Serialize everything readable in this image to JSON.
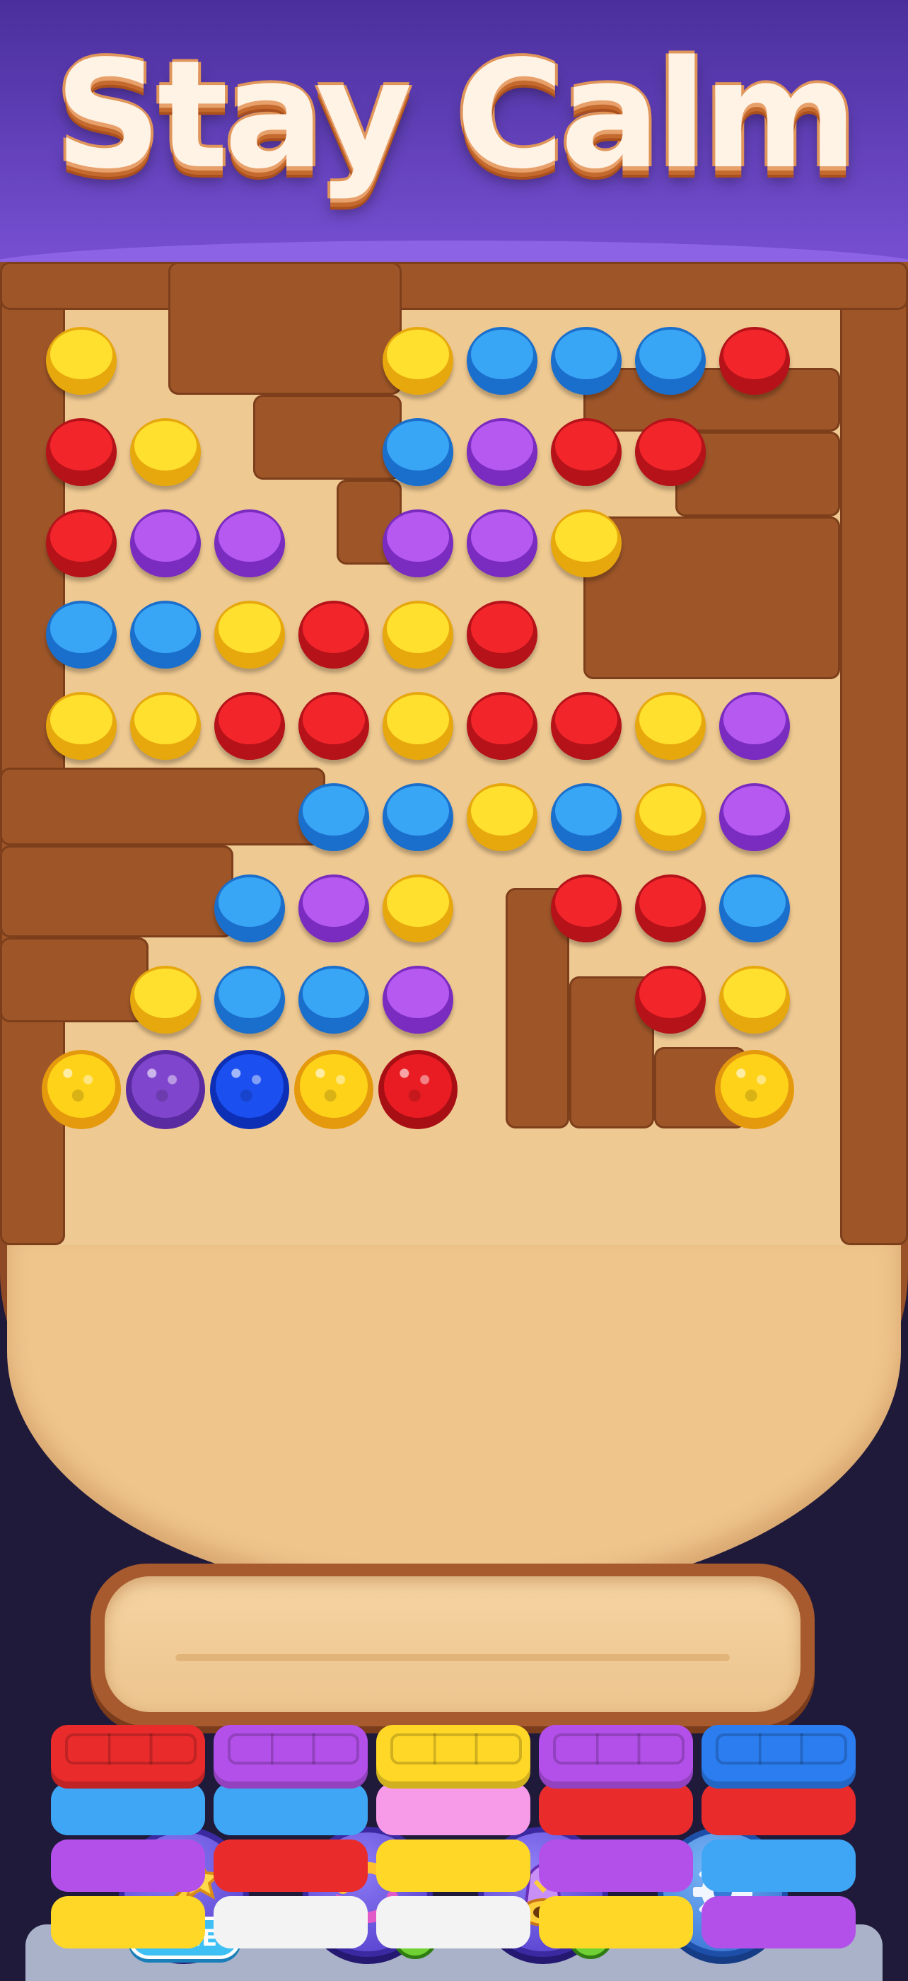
{
  "level_title": "Stay Calm",
  "colors": {
    "yellow": "#ffe02e",
    "blue": "#39a6f5",
    "red": "#f2262a",
    "purple": "#b559f0"
  },
  "board": {
    "discs": [
      {
        "row": 0,
        "col": 0,
        "color": "yellow"
      },
      {
        "row": 0,
        "col": 4,
        "color": "yellow"
      },
      {
        "row": 0,
        "col": 5,
        "color": "blue"
      },
      {
        "row": 0,
        "col": 6,
        "color": "blue"
      },
      {
        "row": 0,
        "col": 7,
        "color": "blue"
      },
      {
        "row": 0,
        "col": 8,
        "color": "red"
      },
      {
        "row": 1,
        "col": 0,
        "color": "red"
      },
      {
        "row": 1,
        "col": 1,
        "color": "yellow"
      },
      {
        "row": 1,
        "col": 4,
        "color": "blue"
      },
      {
        "row": 1,
        "col": 5,
        "color": "purple"
      },
      {
        "row": 1,
        "col": 6,
        "color": "red"
      },
      {
        "row": 1,
        "col": 7,
        "color": "red"
      },
      {
        "row": 2,
        "col": 0,
        "color": "red"
      },
      {
        "row": 2,
        "col": 1,
        "color": "purple"
      },
      {
        "row": 2,
        "col": 2,
        "color": "purple"
      },
      {
        "row": 2,
        "col": 4,
        "color": "purple"
      },
      {
        "row": 2,
        "col": 5,
        "color": "purple"
      },
      {
        "row": 2,
        "col": 6,
        "color": "yellow"
      },
      {
        "row": 3,
        "col": 0,
        "color": "blue"
      },
      {
        "row": 3,
        "col": 1,
        "color": "blue"
      },
      {
        "row": 3,
        "col": 2,
        "color": "yellow"
      },
      {
        "row": 3,
        "col": 3,
        "color": "red"
      },
      {
        "row": 3,
        "col": 4,
        "color": "yellow"
      },
      {
        "row": 3,
        "col": 5,
        "color": "red"
      },
      {
        "row": 4,
        "col": 0,
        "color": "yellow"
      },
      {
        "row": 4,
        "col": 1,
        "color": "yellow"
      },
      {
        "row": 4,
        "col": 2,
        "color": "red"
      },
      {
        "row": 4,
        "col": 3,
        "color": "red"
      },
      {
        "row": 4,
        "col": 4,
        "color": "yellow"
      },
      {
        "row": 4,
        "col": 5,
        "color": "red"
      },
      {
        "row": 4,
        "col": 6,
        "color": "red"
      },
      {
        "row": 4,
        "col": 7,
        "color": "yellow"
      },
      {
        "row": 4,
        "col": 8,
        "color": "purple"
      },
      {
        "row": 5,
        "col": 3,
        "color": "blue"
      },
      {
        "row": 5,
        "col": 4,
        "color": "blue"
      },
      {
        "row": 5,
        "col": 5,
        "color": "yellow"
      },
      {
        "row": 5,
        "col": 6,
        "color": "blue"
      },
      {
        "row": 5,
        "col": 7,
        "color": "yellow"
      },
      {
        "row": 5,
        "col": 8,
        "color": "purple"
      },
      {
        "row": 6,
        "col": 2,
        "color": "blue"
      },
      {
        "row": 6,
        "col": 3,
        "color": "purple"
      },
      {
        "row": 6,
        "col": 4,
        "color": "yellow"
      },
      {
        "row": 6,
        "col": 6,
        "color": "red"
      },
      {
        "row": 6,
        "col": 7,
        "color": "red"
      },
      {
        "row": 6,
        "col": 8,
        "color": "blue"
      },
      {
        "row": 7,
        "col": 1,
        "color": "yellow"
      },
      {
        "row": 7,
        "col": 2,
        "color": "blue"
      },
      {
        "row": 7,
        "col": 3,
        "color": "blue"
      },
      {
        "row": 7,
        "col": 4,
        "color": "purple"
      },
      {
        "row": 7,
        "col": 7,
        "color": "red"
      },
      {
        "row": 7,
        "col": 8,
        "color": "yellow"
      }
    ],
    "buckets": [
      {
        "col": 0,
        "color": "yellow"
      },
      {
        "col": 1,
        "color": "purple"
      },
      {
        "col": 2,
        "color": "blue"
      },
      {
        "col": 3,
        "color": "yellow"
      },
      {
        "col": 4,
        "color": "red"
      },
      {
        "col": 8,
        "color": "yellow"
      }
    ]
  },
  "collector_tray": {
    "slots_filled": 0
  },
  "racks": [
    [
      "red",
      "lblue",
      "purple",
      "yellow"
    ],
    [
      "purple",
      "lblue",
      "red",
      "white"
    ],
    [
      "yellow",
      "pink",
      "yellow",
      "white"
    ],
    [
      "purple",
      "red",
      "purple",
      "yellow"
    ],
    [
      "blue",
      "red",
      "lblue",
      "purple"
    ]
  ],
  "toolbar": {
    "magic_wand": {
      "badge": "FREE"
    },
    "shuffle": {
      "plus": "+"
    },
    "cannon": {
      "plus": "+"
    },
    "settings": {}
  }
}
